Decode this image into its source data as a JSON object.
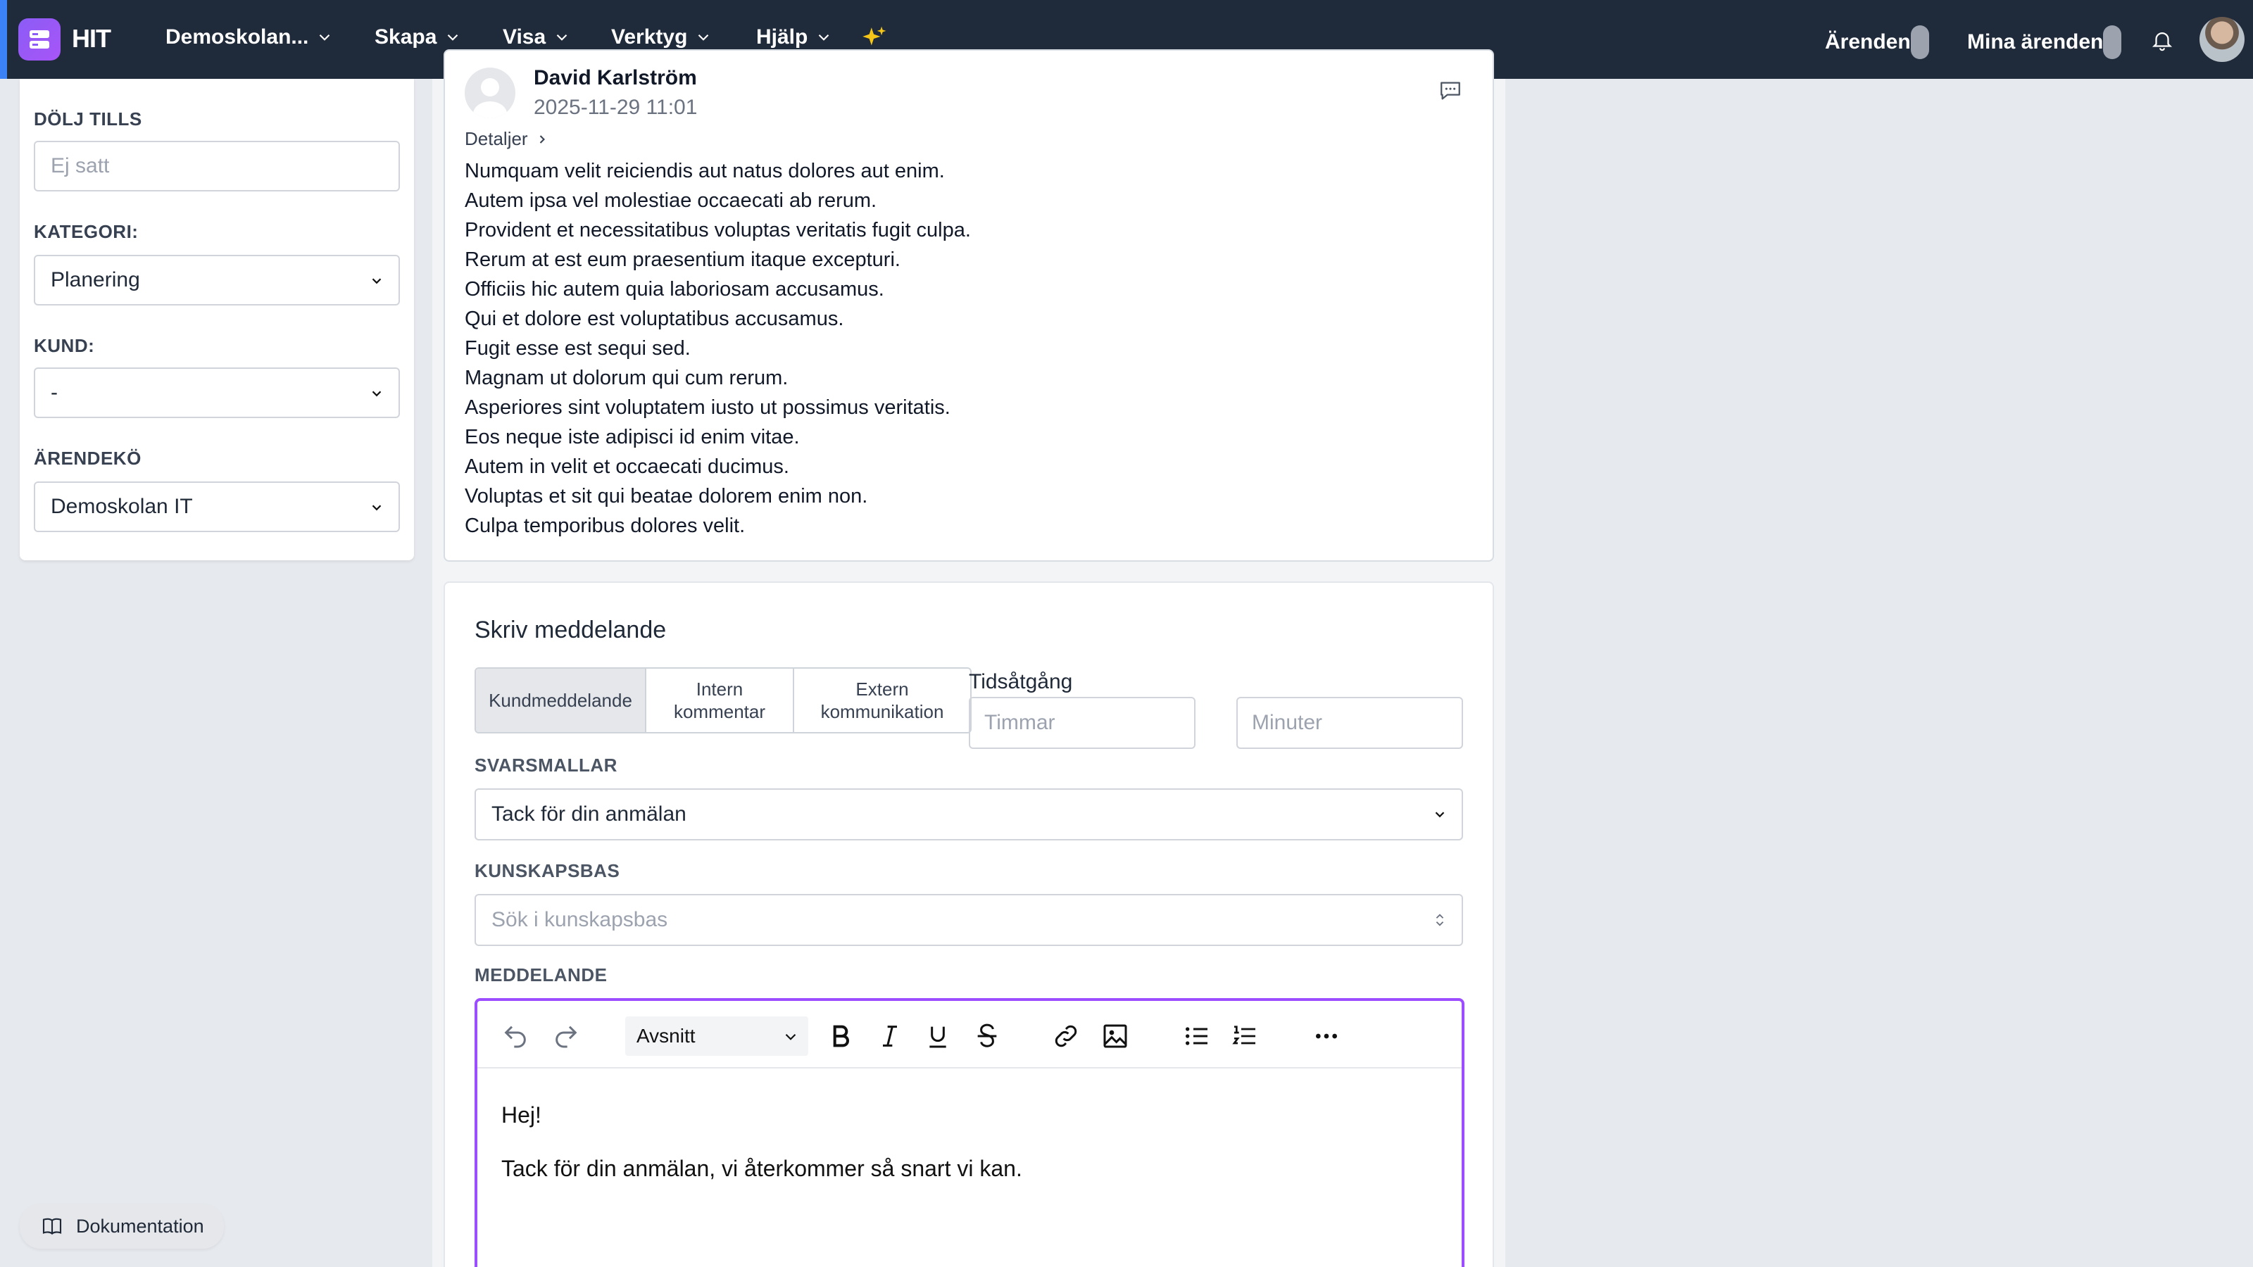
{
  "app": {
    "name": "HIT"
  },
  "nav": {
    "items": [
      "Demoskolan...",
      "Skapa",
      "Visa",
      "Verktyg",
      "Hjälp"
    ],
    "right": {
      "tickets": "Ärenden",
      "my_tickets": "Mina ärenden"
    }
  },
  "sidebar": {
    "hide_until_label": "DÖLJ TILLS",
    "hide_until_placeholder": "Ej satt",
    "category_label": "KATEGORI:",
    "category_value": "Planering",
    "customer_label": "KUND:",
    "customer_value": "-",
    "queue_label": "ÄRENDEKÖ",
    "queue_value": "Demoskolan IT"
  },
  "message": {
    "author": "David Karlström",
    "date": "2025-11-29 11:01",
    "details_label": "Detaljer",
    "lines": [
      "Numquam velit reiciendis aut natus dolores aut enim.",
      "Autem ipsa vel molestiae occaecati ab rerum.",
      "Provident et necessitatibus voluptas veritatis fugit culpa.",
      "Rerum at est eum praesentium itaque excepturi.",
      "Officiis hic autem quia laboriosam accusamus.",
      "Qui et dolore est voluptatibus accusamus.",
      "Fugit esse est sequi sed.",
      "Magnam ut dolorum qui cum rerum.",
      "Asperiores sint voluptatem iusto ut possimus veritatis.",
      "Eos neque iste adipisci id enim vitae.",
      "Autem in velit et occaecati ducimus.",
      "Voluptas et sit qui beatae dolorem enim non.",
      "Culpa temporibus dolores velit."
    ]
  },
  "compose": {
    "title": "Skriv meddelande",
    "types": [
      "Kundmeddelande",
      "Intern kommentar",
      "Extern kommunikation"
    ],
    "active_type": "Kundmeddelande",
    "time_label": "Tidsåtgång",
    "hours_placeholder": "Timmar",
    "minutes_placeholder": "Minuter",
    "templates_label": "SVARSMALLAR",
    "template_value": "Tack för din anmälan",
    "kb_label": "KUNSKAPSBAS",
    "kb_placeholder": "Sök i kunskapsbas",
    "message_label": "MEDDELANDE",
    "format_value": "Avsnitt",
    "editor_lines": [
      "Hej!",
      "Tack för din anmälan, vi återkommer så snart vi kan."
    ]
  },
  "docs_button": "Dokumentation",
  "colors": {
    "nav_bg": "#1f2a3a",
    "accent": "#9b4dff",
    "sparkle": "#f5c518"
  }
}
